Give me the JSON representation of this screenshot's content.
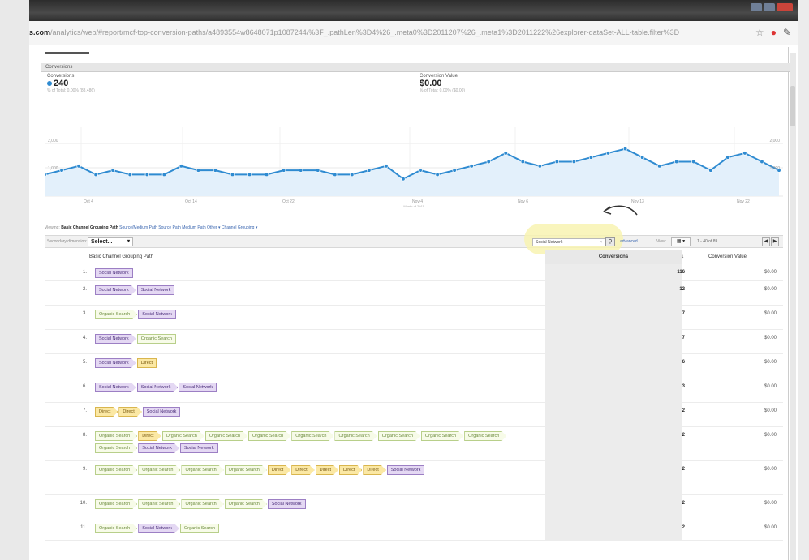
{
  "browser": {
    "url_domain": "s.com",
    "url_rest": "/analytics/web/#report/mcf-top-conversion-paths/a4893554w8648071p1087244/%3F_.pathLen%3D4%26_.meta0%3D2011207%26_.meta1%3D2011222%26explorer-dataSet-ALL-table.filter%3D",
    "icons": [
      "star-icon",
      "opera-icon",
      "wrench-icon"
    ]
  },
  "section": {
    "title": "Conversions"
  },
  "metrics": [
    {
      "title": "Conversions",
      "value": "240",
      "sub": "% of Total: 0.00% (88,486)",
      "color": "#2f8bd1"
    },
    {
      "title": "Conversion Value",
      "value": "$0.00",
      "sub": "% of Total: 0.00% ($0.00)"
    }
  ],
  "chart_data": {
    "type": "area",
    "series": [
      {
        "values": [
          5,
          6,
          7,
          5,
          6,
          5,
          5,
          5,
          7,
          6,
          6,
          5,
          5,
          5,
          6,
          6,
          6,
          5,
          5,
          6,
          7,
          4,
          6,
          5,
          6,
          7,
          8,
          10,
          8,
          7,
          8,
          8,
          9,
          10,
          11,
          9,
          7,
          8,
          8,
          6,
          9,
          10,
          8,
          6
        ],
        "color": "#2f8bd1"
      }
    ],
    "y_ticks": [
      "2,000",
      "1,000"
    ],
    "x_ticks": [
      "Oct 4",
      "Oct 14",
      "Oct 22",
      "Nov 4",
      "Nov 6",
      "Nov 13",
      "Nov 22"
    ],
    "x_caption": "Month of 2011",
    "ylim": [
      0,
      16
    ],
    "grid": true
  },
  "viewbar": {
    "prefix": "Viewing:",
    "active": "Basic Channel Grouping Path",
    "links": [
      "Source/Medium Path",
      "Source Path",
      "Medium Path",
      "Other ▾",
      "Channel Grouping ▾"
    ]
  },
  "controls": {
    "secondary_label": "Secondary dimension:",
    "select_label": "Select...",
    "search_value": "Social Network",
    "search_clear": "×",
    "advanced": "advanced",
    "view_label": "View:",
    "view_btn": "▦ ▾",
    "page_info": "1 - 40 of 89",
    "prev": "◀",
    "next": "▶"
  },
  "table": {
    "headers": [
      "Basic Channel Grouping Path",
      "Conversions",
      "↓",
      "Conversion Value"
    ],
    "rows": [
      {
        "num": "1.",
        "path": [
          [
            "Social Network",
            "sn"
          ]
        ],
        "conversions": "116",
        "value": "$0.00"
      },
      {
        "num": "2.",
        "path": [
          [
            "Social Network",
            "sn"
          ],
          [
            "Social Network",
            "sn"
          ]
        ],
        "conversions": "12",
        "value": "$0.00"
      },
      {
        "num": "3.",
        "path": [
          [
            "Organic Search",
            "os"
          ],
          [
            "Social Network",
            "sn"
          ]
        ],
        "conversions": "7",
        "value": "$0.00"
      },
      {
        "num": "4.",
        "path": [
          [
            "Social Network",
            "sn"
          ],
          [
            "Organic Search",
            "os"
          ]
        ],
        "conversions": "7",
        "value": "$0.00"
      },
      {
        "num": "5.",
        "path": [
          [
            "Social Network",
            "sn"
          ],
          [
            "Direct",
            "dr"
          ]
        ],
        "conversions": "6",
        "value": "$0.00"
      },
      {
        "num": "6.",
        "path": [
          [
            "Social Network",
            "sn"
          ],
          [
            "Social Network",
            "sn"
          ],
          [
            "Social Network",
            "sn"
          ]
        ],
        "conversions": "3",
        "value": "$0.00"
      },
      {
        "num": "7.",
        "path": [
          [
            "Direct",
            "dr"
          ],
          [
            "Direct",
            "dr"
          ],
          [
            "Social Network",
            "sn"
          ]
        ],
        "conversions": "2",
        "value": "$0.00"
      },
      {
        "num": "8.",
        "path": [
          [
            "Organic Search",
            "os"
          ],
          [
            "Direct",
            "dr"
          ],
          [
            "Organic Search",
            "os"
          ],
          [
            "Organic Search",
            "os"
          ],
          [
            "Organic Search",
            "os"
          ],
          [
            "Organic Search",
            "os"
          ],
          [
            "Organic Search",
            "os"
          ],
          [
            "Organic Search",
            "os"
          ],
          [
            "Organic Search",
            "os"
          ],
          [
            "Organic Search",
            "os"
          ],
          [
            "Organic Search",
            "os"
          ],
          [
            "Social Network",
            "sn"
          ],
          [
            "Social Network",
            "sn"
          ]
        ],
        "conversions": "2",
        "value": "$0.00"
      },
      {
        "num": "9.",
        "path": [
          [
            "Organic Search",
            "os"
          ],
          [
            "Organic Search",
            "os"
          ],
          [
            "Organic Search",
            "os"
          ],
          [
            "Organic Search",
            "os"
          ],
          [
            "Direct",
            "dr"
          ],
          [
            "Direct",
            "dr"
          ],
          [
            "Direct",
            "dr"
          ],
          [
            "Direct",
            "dr"
          ],
          [
            "Direct",
            "dr"
          ],
          [
            "Social Network",
            "sn"
          ]
        ],
        "conversions": "2",
        "value": "$0.00"
      },
      {
        "num": "10.",
        "path": [
          [
            "Organic Search",
            "os"
          ],
          [
            "Organic Search",
            "os"
          ],
          [
            "Organic Search",
            "os"
          ],
          [
            "Organic Search",
            "os"
          ],
          [
            "Social Network",
            "sn"
          ]
        ],
        "conversions": "2",
        "value": "$0.00"
      },
      {
        "num": "11.",
        "path": [
          [
            "Organic Search",
            "os"
          ],
          [
            "Social Network",
            "sn"
          ],
          [
            "Organic Search",
            "os"
          ]
        ],
        "conversions": "2",
        "value": "$0.00"
      }
    ]
  }
}
